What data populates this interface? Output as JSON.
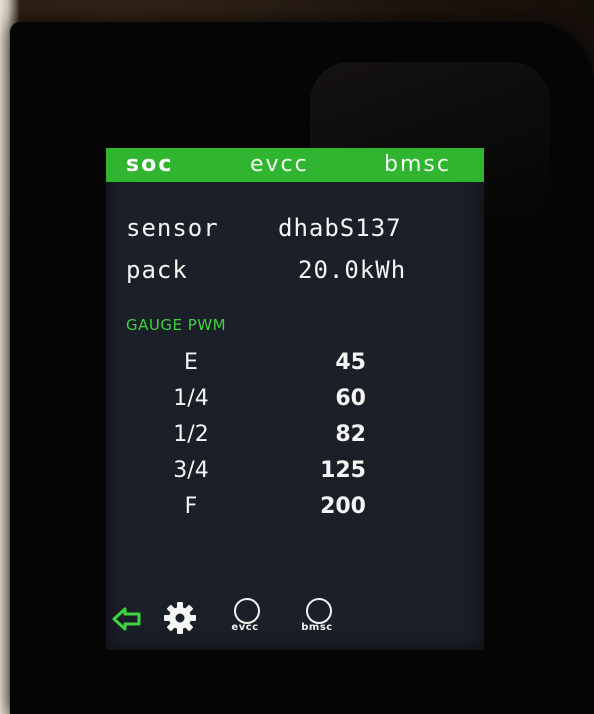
{
  "tabs": [
    {
      "label": "soc",
      "active": true
    },
    {
      "label": "evcc",
      "active": false
    },
    {
      "label": "bmsc",
      "active": false
    }
  ],
  "info": {
    "sensor_label": "sensor",
    "sensor_value": "dhabS137",
    "pack_label": "pack",
    "pack_value": "20.0kWh"
  },
  "gauge": {
    "heading": "GAUGE PWM",
    "rows": [
      {
        "position": "E",
        "value": "45"
      },
      {
        "position": "1/4",
        "value": "60"
      },
      {
        "position": "1/2",
        "value": "82"
      },
      {
        "position": "3/4",
        "value": "125"
      },
      {
        "position": "F",
        "value": "200"
      }
    ]
  },
  "bottom": {
    "back_icon": "arrow-left-icon",
    "settings_icon": "gear-icon",
    "evcc_label": "evcc",
    "bmsc_label": "bmsc"
  },
  "colors": {
    "tab_bar": "#2fb52f",
    "accent_green": "#3fd23f",
    "screen_bg": "#1b1f27"
  }
}
